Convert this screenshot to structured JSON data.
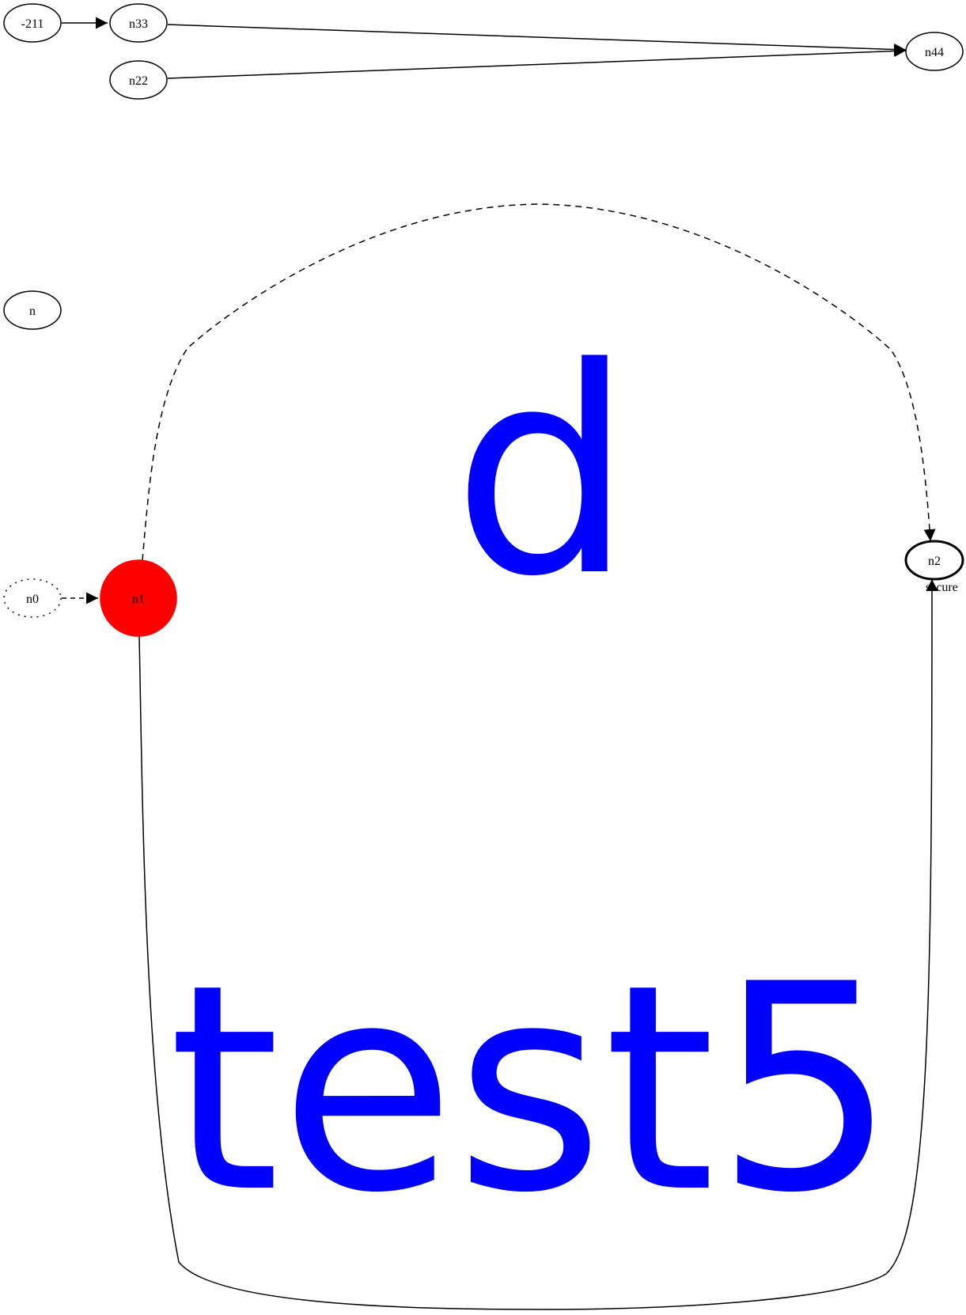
{
  "graph": {
    "nodes": [
      {
        "id": "-211",
        "label": "-211"
      },
      {
        "id": "n33",
        "label": "n33"
      },
      {
        "id": "n22",
        "label": "n22"
      },
      {
        "id": "n44",
        "label": "n44"
      },
      {
        "id": "n",
        "label": "n"
      },
      {
        "id": "n0",
        "label": "n0",
        "style": "dotted"
      },
      {
        "id": "n1",
        "label": "n1",
        "style": "filled",
        "fill": "#ff0000"
      },
      {
        "id": "n2",
        "label": "n2",
        "style": "bold"
      }
    ],
    "edges": [
      {
        "from": "-211",
        "to": "n33",
        "style": "solid"
      },
      {
        "from": "n33",
        "to": "n44",
        "style": "solid"
      },
      {
        "from": "n22",
        "to": "n44",
        "style": "solid"
      },
      {
        "from": "n0",
        "to": "n1",
        "style": "dashed"
      },
      {
        "from": "n1",
        "to": "n2",
        "style": "dashed"
      },
      {
        "from": "n1",
        "to": "n2",
        "style": "solid",
        "label": "secure"
      }
    ],
    "labels": {
      "big_d": "d",
      "big_test5": "test5"
    },
    "colors": {
      "text": "#0000ff",
      "n1_fill": "#ff0000",
      "stroke": "#000000"
    }
  }
}
